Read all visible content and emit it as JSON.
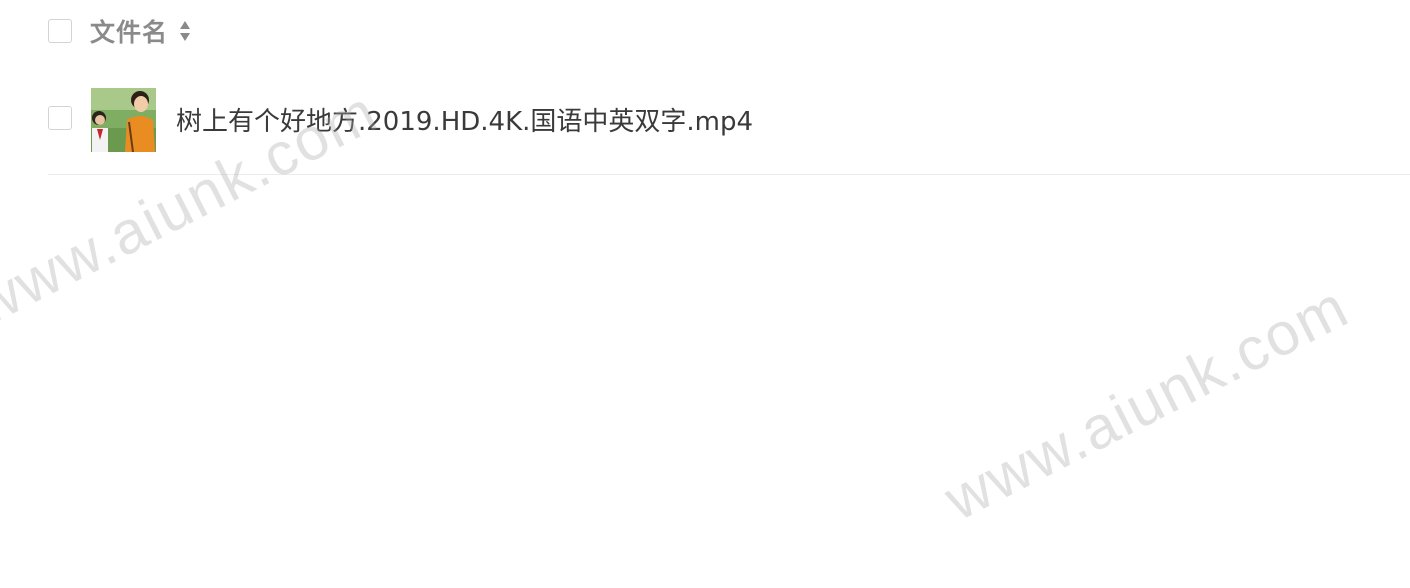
{
  "table": {
    "header": {
      "column_title": "文件名",
      "sort_icon": "sort-updown-icon"
    },
    "rows": [
      {
        "file_name": "树上有个好地方.2019.HD.4K.国语中英双字.mp4",
        "thumbnail": "video-thumbnail"
      }
    ]
  },
  "watermark": {
    "text": "www.aiunk.com"
  },
  "colors": {
    "header_text": "#8a8a8a",
    "file_text": "#3a3a3a",
    "checkbox_border": "#d4d4d4",
    "divider": "#ececec"
  }
}
